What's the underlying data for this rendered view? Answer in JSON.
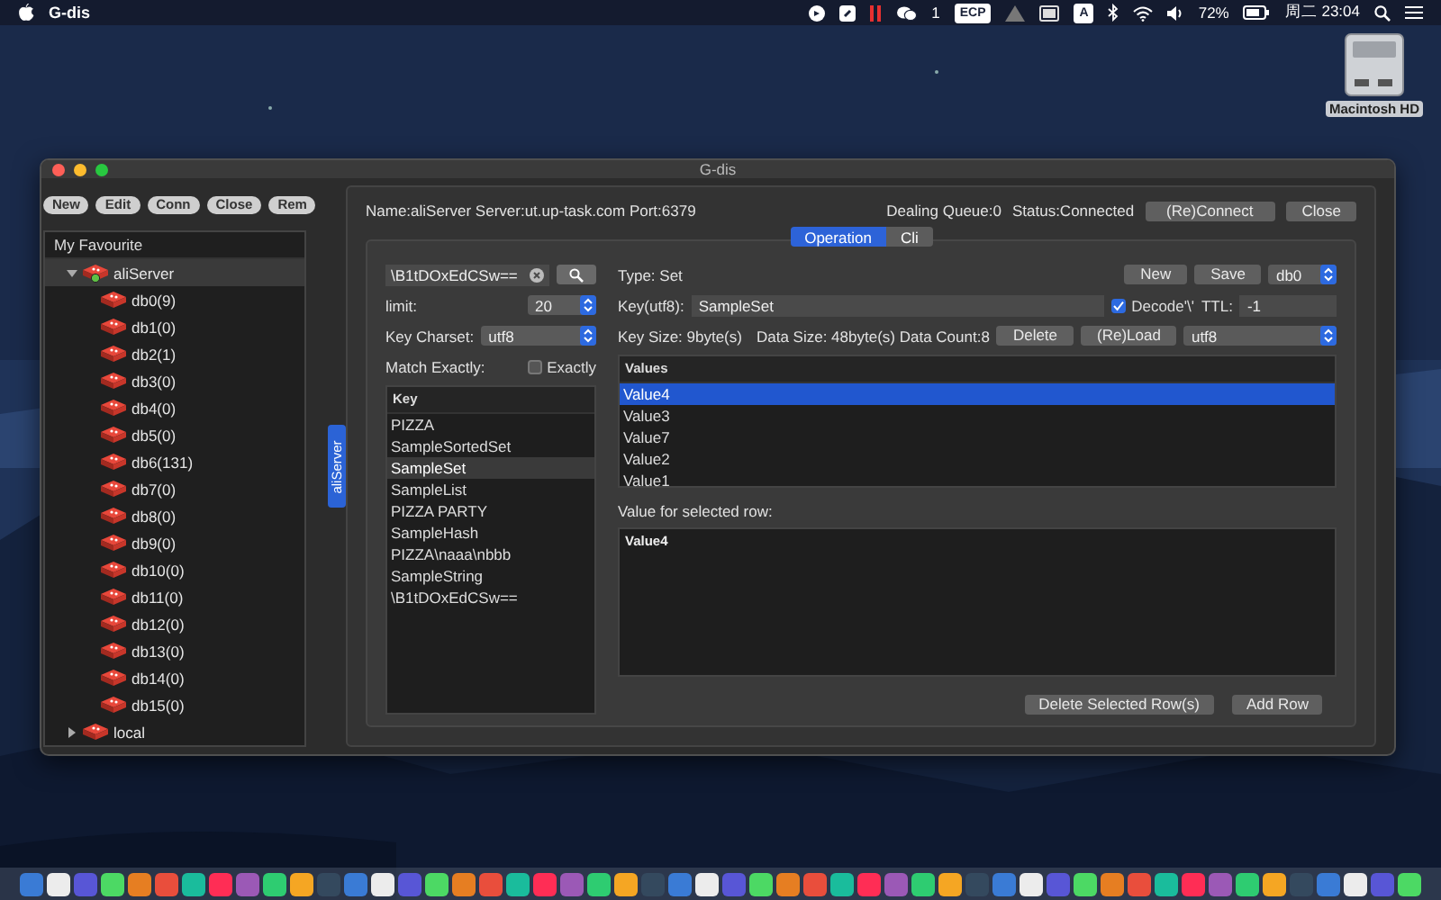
{
  "menu_bar": {
    "app_name": "G-dis",
    "wechat_count": "1",
    "ecp_badge": "ECP",
    "input_badge": "A",
    "battery": "72%",
    "clock": "周二 23:04"
  },
  "desktop_icon": {
    "label": "Macintosh HD"
  },
  "window": {
    "title": "G-dis",
    "toolbar": [
      "New",
      "Edit",
      "Conn",
      "Close",
      "Rem"
    ],
    "sidebar": {
      "header": "My Favourite",
      "servers": [
        {
          "name": "aliServer",
          "expanded": true,
          "connected": true,
          "children": [
            {
              "name": "db0(9)"
            },
            {
              "name": "db1(0)"
            },
            {
              "name": "db2(1)"
            },
            {
              "name": "db3(0)"
            },
            {
              "name": "db4(0)"
            },
            {
              "name": "db5(0)"
            },
            {
              "name": "db6(131)"
            },
            {
              "name": "db7(0)"
            },
            {
              "name": "db8(0)"
            },
            {
              "name": "db9(0)"
            },
            {
              "name": "db10(0)"
            },
            {
              "name": "db11(0)"
            },
            {
              "name": "db12(0)"
            },
            {
              "name": "db13(0)"
            },
            {
              "name": "db14(0)"
            },
            {
              "name": "db15(0)"
            }
          ]
        },
        {
          "name": "local",
          "expanded": false,
          "connected": false
        }
      ]
    },
    "side_tab": "aliServer",
    "info": "Name:aliServer Server:ut.up-task.com Port:6379",
    "queue": "Dealing Queue:0",
    "status": "Status:Connected",
    "header_buttons": [
      "(Re)Connect",
      "Close"
    ],
    "tabs": [
      {
        "label": "Operation",
        "selected": true
      },
      {
        "label": "Cli",
        "selected": false
      }
    ],
    "search": {
      "value": "\\B1tDOxEdCSw=="
    },
    "limit": {
      "label": "limit:",
      "value": "20"
    },
    "key_charset": {
      "label": "Key Charset:",
      "value": "utf8"
    },
    "match": {
      "label": "Match Exactly:",
      "checkbox_label": "Exactly",
      "checked": false
    },
    "keys": {
      "column": "Key",
      "rows": [
        {
          "label": "PIZZA",
          "selected": false
        },
        {
          "label": "SampleSortedSet",
          "selected": false
        },
        {
          "label": "SampleSet",
          "selected": true
        },
        {
          "label": "SampleList",
          "selected": false
        },
        {
          "label": "PIZZA PARTY",
          "selected": false
        },
        {
          "label": "SampleHash",
          "selected": false
        },
        {
          "label": "PIZZA\\naaa\\nbbb",
          "selected": false
        },
        {
          "label": "SampleString",
          "selected": false
        },
        {
          "label": "\\B1tDOxEdCSw==",
          "selected": false
        }
      ]
    },
    "type": "Type: Set",
    "actions": [
      "New",
      "Save"
    ],
    "db_select": "db0",
    "key_field": {
      "label": "Key(utf8):",
      "value": "SampleSet"
    },
    "decode": {
      "label": "Decode'\\'",
      "checked": true
    },
    "ttl": {
      "label": "TTL:",
      "value": "-1"
    },
    "key_size": "Key Size: 9byte(s)",
    "data_size": "Data Size: 48byte(s) Data Count:8",
    "row_buttons": [
      "Delete",
      "(Re)Load"
    ],
    "value_charset": "utf8",
    "values": {
      "column": "Values",
      "rows": [
        {
          "label": "Value4",
          "selected": true
        },
        {
          "label": "Value3",
          "selected": false
        },
        {
          "label": "Value7",
          "selected": false
        },
        {
          "label": "Value2",
          "selected": false
        },
        {
          "label": "Value1",
          "selected": false
        }
      ]
    },
    "detail": {
      "label": "Value for selected row:",
      "value": "Value4"
    },
    "bottom_buttons": [
      "Delete Selected Row(s)",
      "Add Row"
    ]
  }
}
